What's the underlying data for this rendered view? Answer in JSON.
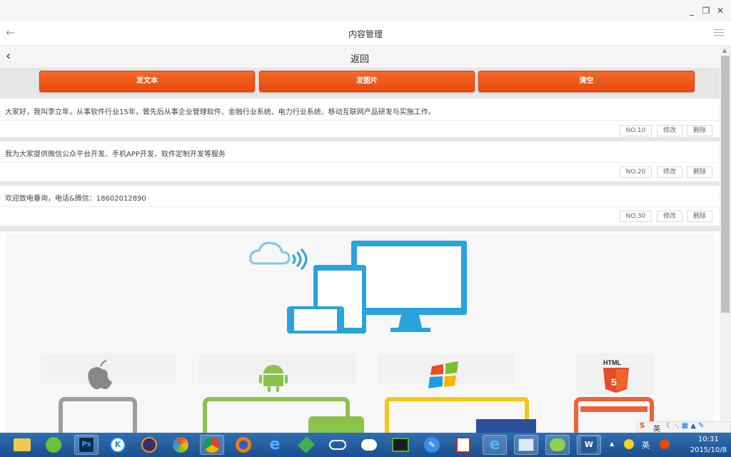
{
  "window": {
    "minimize": "_",
    "restore": "❐",
    "close": "✕"
  },
  "appbar": {
    "back": "←",
    "title": "内容管理"
  },
  "navbar": {
    "back": "‹",
    "title": "返回"
  },
  "buttons": {
    "text": "发文本",
    "image": "发图片",
    "clear": "清空"
  },
  "items": [
    {
      "text": "大家好，我叫李立年，从事软件行业15年，曾先后从事企业管理软件、金融行业系统、电力行业系统、移动互联网产品研发与实施工作。",
      "no": "NO.10",
      "edit": "修改",
      "del": "删除"
    },
    {
      "text": "我为大家提供微信公众平台开发、手机APP开发、软件定制开发等服务",
      "no": "NO.20",
      "edit": "修改",
      "del": "删除"
    },
    {
      "text": "欢迎致电垂询，电话&微信：18602012890",
      "no": "NO.30",
      "edit": "修改",
      "del": "删除"
    }
  ],
  "image": {
    "html5_label": "HTML"
  },
  "ime": {
    "logo": "S",
    "lang": "英"
  },
  "tray": {
    "lang": "英",
    "time": "10:31",
    "date": "2015/10/8"
  },
  "colors": {
    "accent": "#ee5413",
    "illustration_blue": "#29a3dd"
  }
}
